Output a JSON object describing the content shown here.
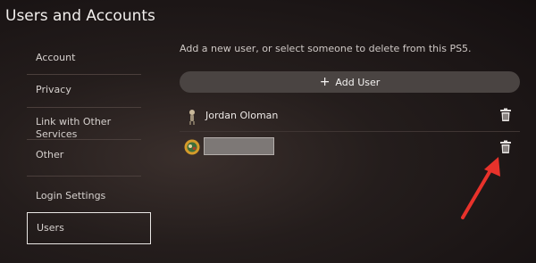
{
  "header": {
    "title": "Users and Accounts"
  },
  "sidebar": {
    "items": [
      {
        "label": "Account"
      },
      {
        "label": "Privacy"
      },
      {
        "label": "Link with Other Services"
      },
      {
        "label": "Other"
      },
      {
        "label": "Login Settings"
      },
      {
        "label": "Users",
        "selected": true
      }
    ]
  },
  "main": {
    "hint": "Add a new user, or select someone to delete from this PS5.",
    "add_user_label": "Add User",
    "users": [
      {
        "name": "Jordan Oloman",
        "delete_icon": "trash-icon"
      },
      {
        "name": "",
        "name_redacted": true,
        "delete_icon": "trash-icon"
      }
    ]
  },
  "colors": {
    "selected_border": "#e9e6e4",
    "annotation_arrow": "#e8322b",
    "button_bg": "#4a4442"
  }
}
